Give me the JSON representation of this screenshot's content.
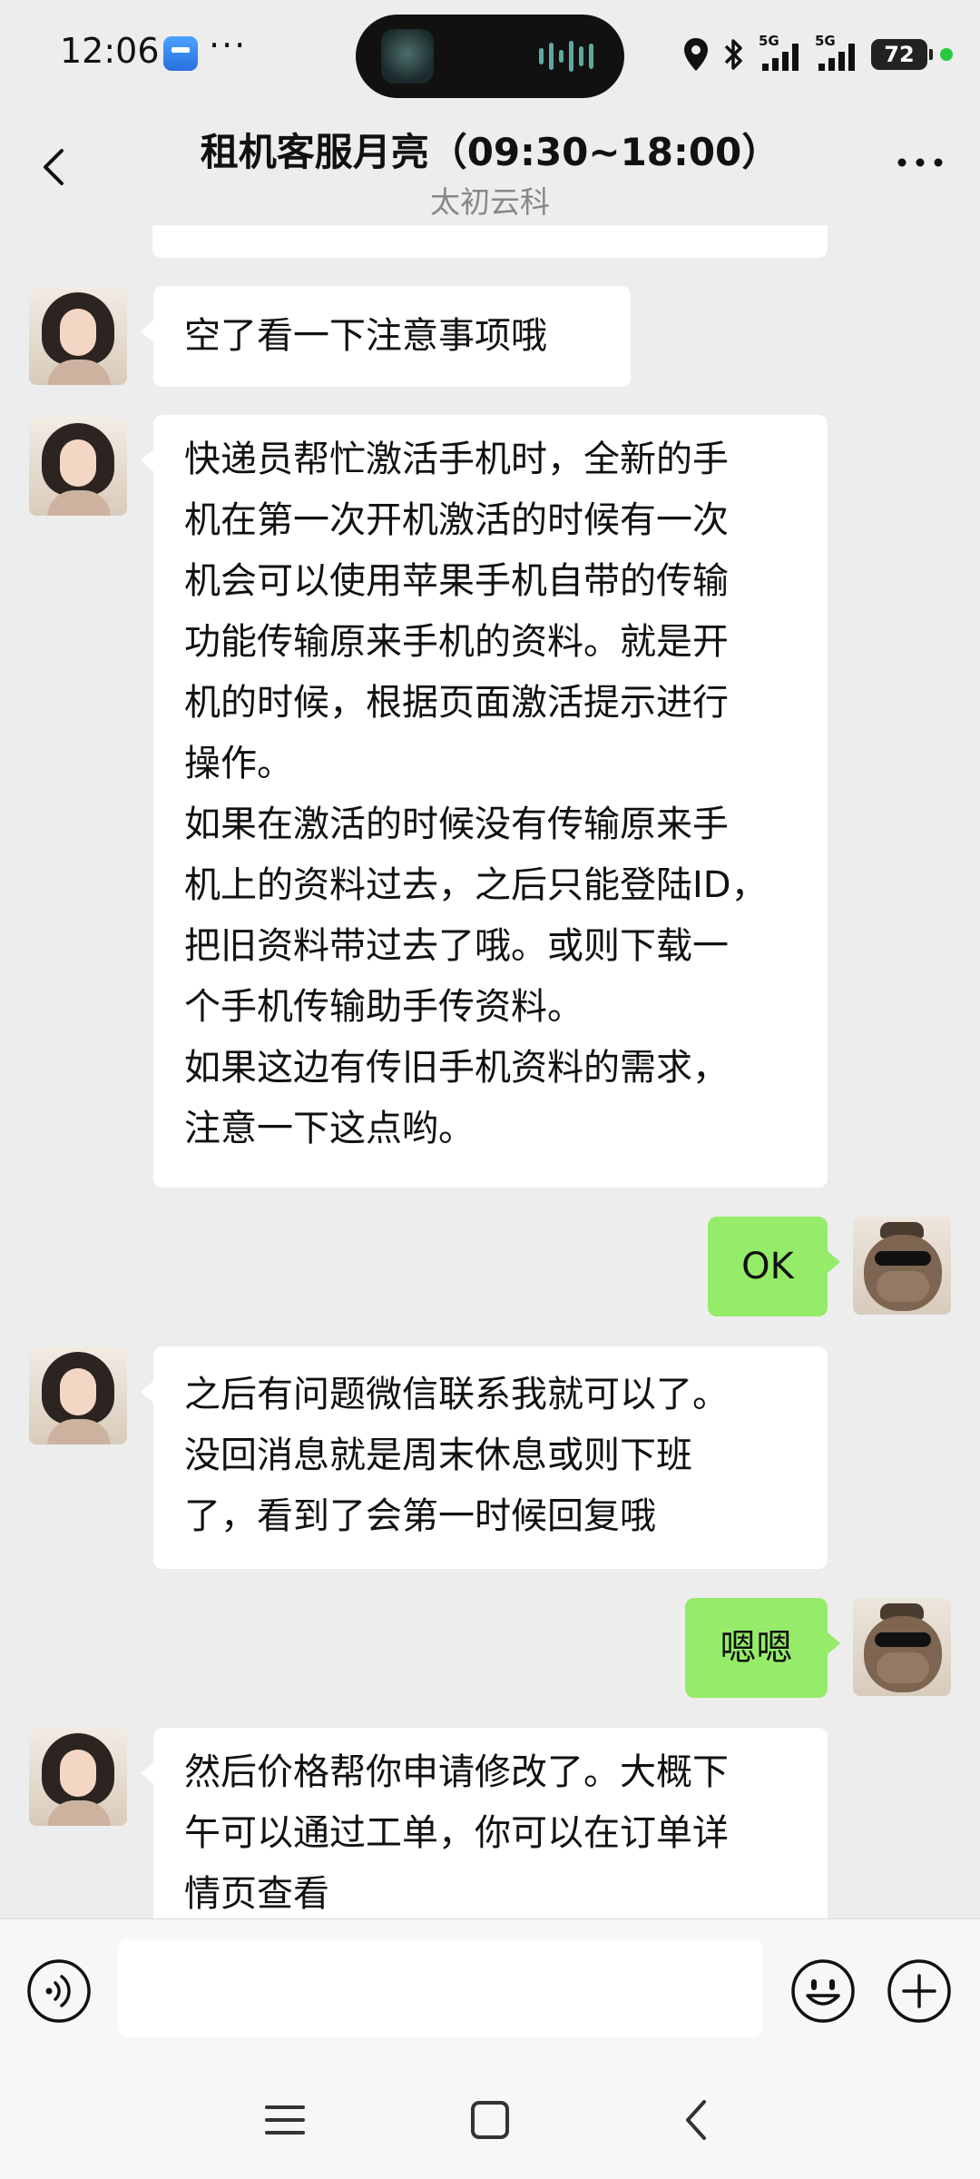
{
  "status_bar": {
    "time": "12:06",
    "dots": "···",
    "signal1": "5G",
    "signal2": "5G",
    "battery": "72"
  },
  "header": {
    "title": "租机客服月亮（09:30~18:00）",
    "subtitle": "太初云科"
  },
  "messages": [
    {
      "sender": "agent",
      "text": "空了看一下注意事项哦"
    },
    {
      "sender": "agent",
      "text": "快递员帮忙激活手机时，全新的手\n机在第一次开机激活的时候有一次\n机会可以使用苹果手机自带的传输\n功能传输原来手机的资料。就是开\n机的时候，根据页面激活提示进行\n操作。\n如果在激活的时候没有传输原来手\n机上的资料过去，之后只能登陆ID，\n把旧资料带过去了哦。或则下载一\n个手机传输助手传资料。\n如果这边有传旧手机资料的需求，\n注意一下这点哟。"
    },
    {
      "sender": "me",
      "text": "OK"
    },
    {
      "sender": "agent",
      "text": "之后有问题微信联系我就可以了。\n没回消息就是周末休息或则下班\n了，看到了会第一时候回复哦"
    },
    {
      "sender": "me",
      "text": "嗯嗯"
    },
    {
      "sender": "agent",
      "text": "然后价格帮你申请修改了。大概下\n午可以通过工单，你可以在订单详\n情页查看"
    }
  ],
  "input": {
    "value": ""
  },
  "colors": {
    "background": "#ededed",
    "my_bubble": "#95ec69",
    "other_bubble": "#ffffff"
  },
  "icons": [
    "back-icon",
    "more-icon",
    "voice-icon",
    "emoji-icon",
    "plus-icon",
    "menu-icon",
    "home-icon",
    "nav-back-icon"
  ]
}
